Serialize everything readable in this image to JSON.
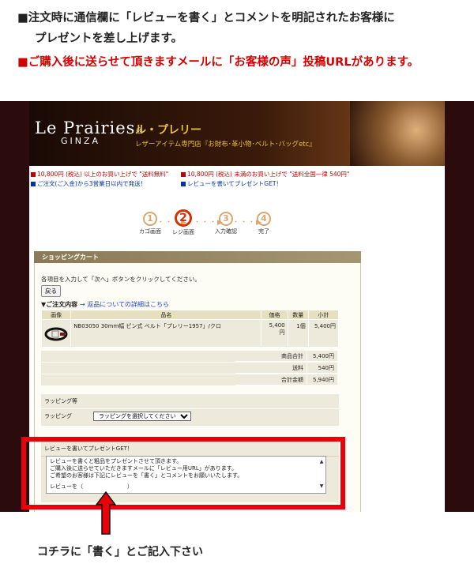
{
  "intro": {
    "line1": "■注文時に通信欄に「レビューを書く」とコメントを明記されたお客様に",
    "line2": "プレゼントを差し上げます。",
    "line3": "■ご購入後に送らせて頂きますメールに「お客様の声」投稿URLがあります。"
  },
  "banner": {
    "logo": "Le Prairies",
    "logo_mark": "®",
    "logo_sub": "GINZA",
    "brand_jp": "ル・プレリー",
    "tagline": "レザーアイテム専門店『お財布･革小物･ベルト･バッグetc』"
  },
  "notices": {
    "n1": "10,800円 (税込) 以上のお買い上げで \"送料無料\"",
    "n2": "10,800円 (税込) 未満のお買い上げで \"送料全国一律 540円\"",
    "n3": "ご注文(ご入金)から3営業日以内で発送！",
    "n4": "レビューを書いてプレゼントGET！"
  },
  "steps": [
    {
      "num": "1",
      "label": "カゴ画面"
    },
    {
      "num": "2",
      "label": "レジ画面"
    },
    {
      "num": "3",
      "label": "入力確認"
    },
    {
      "num": "4",
      "label": "完了"
    }
  ],
  "steps_connector": "・・・▶",
  "cart": {
    "header": "ショッピングカート",
    "instruction": "各項目を入力して「次へ」ボタンをクリックしてください。",
    "back_button": "戻る",
    "order_title": "▼ご注文内容",
    "order_link": "→ 返品についての詳細はこちら",
    "columns": [
      "画像",
      "品名",
      "価格",
      "数量",
      "小計"
    ],
    "item": {
      "name": "NB03050 30mm幅 ピン式 ベルト「プレリー1957」/クロ",
      "price": "5,400円",
      "qty": "1個",
      "subtotal": "5,400円"
    },
    "totals": [
      {
        "label": "商品合計",
        "value": "5,400円"
      },
      {
        "label": "送料",
        "value": "540円"
      },
      {
        "label": "合計金額",
        "value": "5,940円"
      }
    ]
  },
  "wrapping": {
    "title": "ラッピング等",
    "label": "ラッピング",
    "select_value": "ラッピングを選択してください"
  },
  "review": {
    "title": "レビューを書いてプレゼントGET！",
    "lines": [
      "レビューを書くと粗品をプレゼントさせて頂きます。",
      "ご購入後に送らせていただきますメールに「レビュー用URL」があります。",
      "ご希望のお客様は下記にレビューを「書く」とコメントをお願いいたします。",
      "レビューを（　　　　　　　　）"
    ]
  },
  "cta": "コチラに「書く」とご記入下さい",
  "colors": {
    "highlight": "#e8000b",
    "header_bar": "#8a7a55",
    "frame": "#2b0b0b"
  }
}
